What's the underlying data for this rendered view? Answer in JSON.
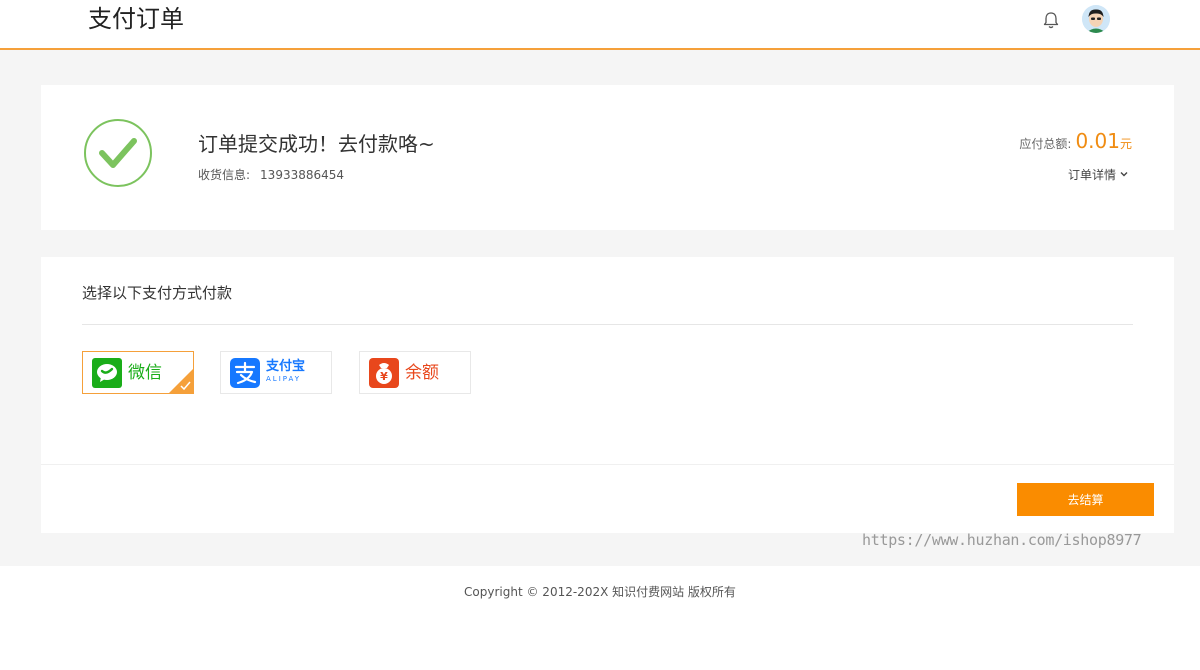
{
  "header": {
    "title": "支付订单",
    "bell_icon": "bell-icon",
    "avatar_icon": "user-avatar"
  },
  "success": {
    "icon": "check-circle-icon",
    "title": "订单提交成功！去付款咯~",
    "receipt_label": "收货信息:",
    "receipt_value": "13933886454",
    "amount_label": "应付总额:",
    "amount_value": "0.01",
    "amount_unit": "元",
    "detail_label": "订单详情",
    "detail_icon": "chevron-down-icon"
  },
  "payment": {
    "heading": "选择以下支付方式付款",
    "methods": [
      {
        "id": "wechat",
        "label": "微信",
        "icon": "wechat-icon",
        "selected": true,
        "color": "#1aad19"
      },
      {
        "id": "alipay",
        "label": "支付宝",
        "sublabel": "ALIPAY",
        "icon": "alipay-icon",
        "selected": false,
        "color": "#1678ff"
      },
      {
        "id": "balance",
        "label": "余额",
        "icon": "balance-icon",
        "selected": false,
        "color": "#e8471c"
      }
    ],
    "checkout_label": "去结算"
  },
  "watermark": "https://www.huzhan.com/ishop8977",
  "footer": {
    "copyright": "Copyright © 2012-202X 知识付费网站 版权所有"
  },
  "colors": {
    "accent": "#f5a03a",
    "button": "#fa8c00",
    "amount": "#f08c12",
    "success_green": "#7cc35e"
  }
}
